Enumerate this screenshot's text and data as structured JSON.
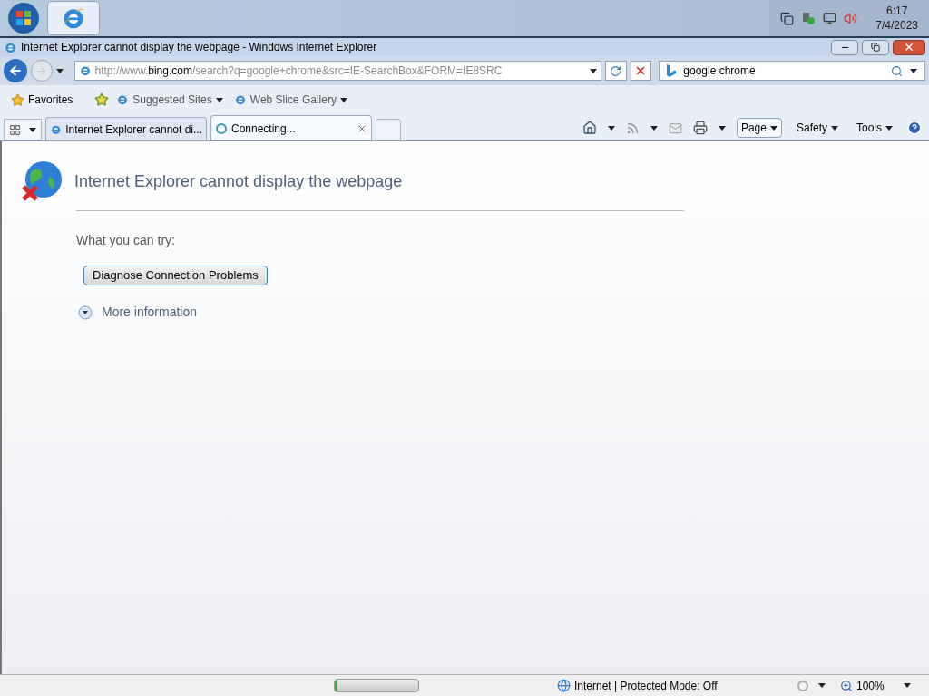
{
  "taskbar": {
    "buttons": [
      {
        "kind": "start"
      },
      {
        "kind": "ie",
        "selected": true
      }
    ],
    "clock": {
      "time": "6:17",
      "date": "7/4/2023"
    }
  },
  "window": {
    "title": "Internet Explorer cannot display the webpage - Windows Internet Explorer"
  },
  "address_bar": {
    "url": "http://www.**bing.com**/search?q=google+chrome&src=IE-SearchBox&FORM=IE8SRC"
  },
  "search": {
    "value": "google chrome"
  },
  "favorites_bar": {
    "favorites": "Favorites",
    "links": [
      "Suggested Sites",
      "Web Slice Gallery"
    ]
  },
  "tabs": [
    {
      "label": "Internet Explorer cannot di...",
      "selected": false,
      "kind": "page"
    },
    {
      "label": "Connecting...",
      "selected": true,
      "kind": "loading"
    }
  ],
  "command_bar": {
    "menus": [
      "Page",
      "Safety",
      "Tools"
    ]
  },
  "error_page": {
    "heading": "Internet Explorer cannot display the webpage",
    "prompt": "What you can try:",
    "button": "Diagnose Connection Problems",
    "more": "More information"
  },
  "status_bar": {
    "progress": {
      "level": 0.03
    },
    "zone": "Internet | Protected Mode: Off",
    "zoom": "100%"
  }
}
